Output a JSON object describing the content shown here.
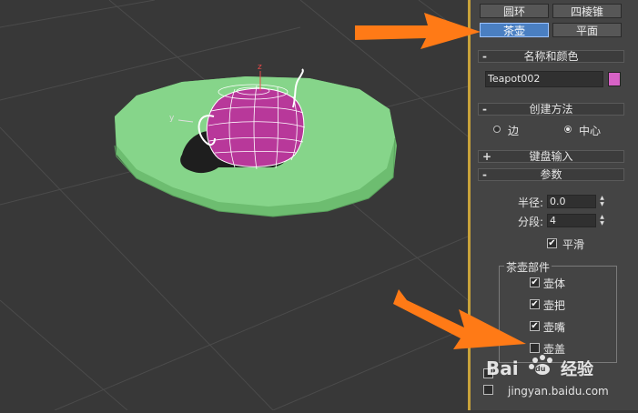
{
  "viewport": {
    "axis_z": "z",
    "axis_y": "y",
    "colors": {
      "plane": "#86d58a",
      "teapot": "#b8389a",
      "arrow": "#ff7a16"
    }
  },
  "create_panel": {
    "buttons": [
      {
        "label": "圆环"
      },
      {
        "label": "四棱锥"
      },
      {
        "label": "茶壶",
        "active": true
      },
      {
        "label": "平面"
      }
    ]
  },
  "name_color": {
    "title": "名称和颜色",
    "sign": "-",
    "name_value": "Teapot002",
    "color": "#d762c6"
  },
  "creation_method": {
    "title": "创建方法",
    "sign": "-",
    "options": [
      {
        "label": "边",
        "selected": false
      },
      {
        "label": "中心",
        "selected": true
      }
    ]
  },
  "keyboard_entry": {
    "title": "键盘输入",
    "sign": "+"
  },
  "parameters": {
    "title": "参数",
    "sign": "-",
    "radius_label": "半径:",
    "radius_value": "0.0",
    "segments_label": "分段:",
    "segments_value": "4",
    "smooth_label": "平滑",
    "smooth_checked": true,
    "parts_title": "茶壶部件",
    "parts": [
      {
        "label": "壶体",
        "checked": true
      },
      {
        "label": "壶把",
        "checked": true
      },
      {
        "label": "壶嘴",
        "checked": true
      },
      {
        "label": "壶盖",
        "checked": false
      }
    ]
  },
  "watermark": {
    "brand": "Bai",
    "paw": "du",
    "text": "经验",
    "url": "jingyan.baidu.com"
  }
}
